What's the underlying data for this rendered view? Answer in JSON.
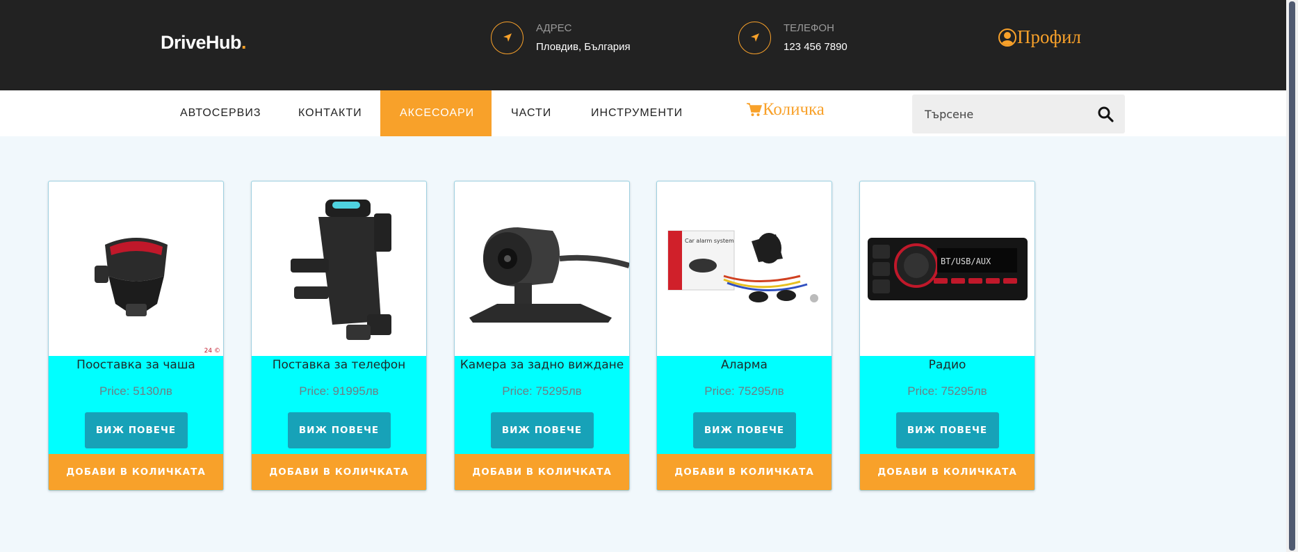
{
  "header": {
    "logo_text": "DriveHub",
    "logo_dot": ".",
    "address": {
      "label": "АДРЕС",
      "value": "Пловдив, България",
      "icon": "location-arrow-icon"
    },
    "phone": {
      "label": "ТЕЛЕФОН",
      "value": "123 456 7890",
      "icon": "location-arrow-icon"
    },
    "profile_label": "Профил"
  },
  "nav": {
    "items": [
      {
        "label": "АВТОСЕРВИЗ"
      },
      {
        "label": "КОНТАКТИ"
      },
      {
        "label": "АКСЕСОАРИ",
        "active": true
      },
      {
        "label": "ЧАСТИ"
      },
      {
        "label": "ИНСТРУМЕНТИ"
      }
    ],
    "cart_label": "Количка",
    "search_placeholder": "Търсене"
  },
  "products": [
    {
      "name": "Пооставка за чаша",
      "price": "Price: 5130лв",
      "more_label": "ВИЖ ПОВЕЧЕ",
      "add_label": "ДОБАВИ В КОЛИЧКАТА",
      "image": "cup-holder",
      "watermark": "24 ©"
    },
    {
      "name": "Поставка за телефон",
      "price": "Price: 91995лв",
      "more_label": "ВИЖ ПОВЕЧЕ",
      "add_label": "ДОБАВИ В КОЛИЧКАТА",
      "image": "phone-holder"
    },
    {
      "name": "Камера за задно виждане",
      "price": "Price: 75295лв",
      "more_label": "ВИЖ ПОВЕЧЕ",
      "add_label": "ДОБАВИ В КОЛИЧКАТА",
      "image": "rear-camera"
    },
    {
      "name": "Аларма",
      "price": "Price: 75295лв",
      "more_label": "ВИЖ ПОВЕЧЕ",
      "add_label": "ДОБАВИ В КОЛИЧКАТА",
      "image": "car-alarm",
      "box_text": "Car alarm system"
    },
    {
      "name": "Радио",
      "price": "Price: 75295лв",
      "more_label": "ВИЖ ПОВЕЧЕ",
      "add_label": "ДОБАВИ В КОЛИЧКАТА",
      "image": "car-radio",
      "display_text": "BT/USB/AUX"
    }
  ],
  "colors": {
    "accent": "#f8a12a",
    "header_bg": "#222222",
    "card_bg": "#00ffff",
    "button": "#17a2b8",
    "page_bg": "#f1f8fc"
  }
}
